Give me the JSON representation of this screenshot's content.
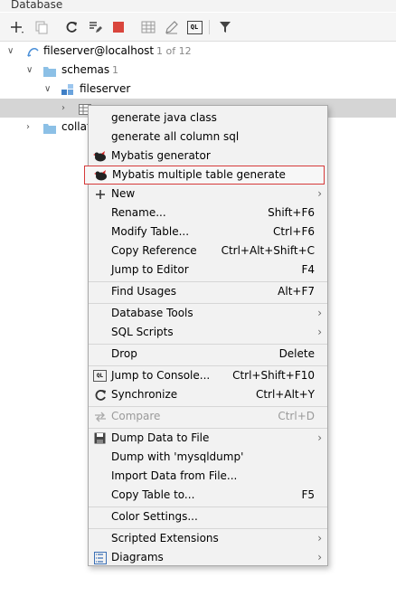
{
  "window": {
    "title": "Database"
  },
  "toolbar": {
    "buttons": [
      {
        "name": "add-icon"
      },
      {
        "name": "duplicate-icon"
      },
      {
        "name": "refresh-icon"
      },
      {
        "name": "sql-edit-icon"
      },
      {
        "name": "stop-icon"
      },
      {
        "name": "table-view-icon"
      },
      {
        "name": "edit-icon"
      },
      {
        "name": "query-console-icon",
        "text": "QL"
      },
      {
        "name": "filter-icon"
      }
    ]
  },
  "tree": {
    "datasource": {
      "label": "fileserver@localhost",
      "count": "1 of 12"
    },
    "schemas": {
      "label": "schemas",
      "count": "1"
    },
    "schema": {
      "label": "fileserver"
    },
    "collations": {
      "label": "collat"
    }
  },
  "menu": {
    "items": [
      {
        "label": "generate java class"
      },
      {
        "label": "generate all column sql"
      },
      {
        "label": "Mybatis generator"
      },
      {
        "label": "Mybatis multiple table generate"
      },
      {
        "label": "New"
      },
      {
        "label_pre": "R",
        "label_u": "",
        "label": "Rename...",
        "shortcut": "Shift+F6"
      },
      {
        "label": "Modify Table...",
        "shortcut": "Ctrl+F6"
      },
      {
        "label": "Copy Reference",
        "shortcut": "Ctrl+Alt+Shift+C"
      },
      {
        "label": "Jump to Editor",
        "shortcut": "F4"
      },
      {
        "label": "Find Usages",
        "shortcut": "Alt+F7"
      },
      {
        "label": "Database Tools"
      },
      {
        "label": "SQL Scripts"
      },
      {
        "label": "Drop",
        "shortcut": "Delete"
      },
      {
        "label": "Jump to Console...",
        "shortcut": "Ctrl+Shift+F10"
      },
      {
        "label": "Synchronize",
        "shortcut": "Ctrl+Alt+Y"
      },
      {
        "label": "Compare",
        "shortcut": "Ctrl+D"
      },
      {
        "label": "Dump Data to File"
      },
      {
        "label": "Dump with 'mysqldump'"
      },
      {
        "label": "Import Data from File..."
      },
      {
        "label": "Copy Table to...",
        "shortcut": "F5"
      },
      {
        "label": "Color Settings..."
      },
      {
        "label": "Scripted Extensions"
      },
      {
        "label": "Diagrams"
      }
    ]
  }
}
